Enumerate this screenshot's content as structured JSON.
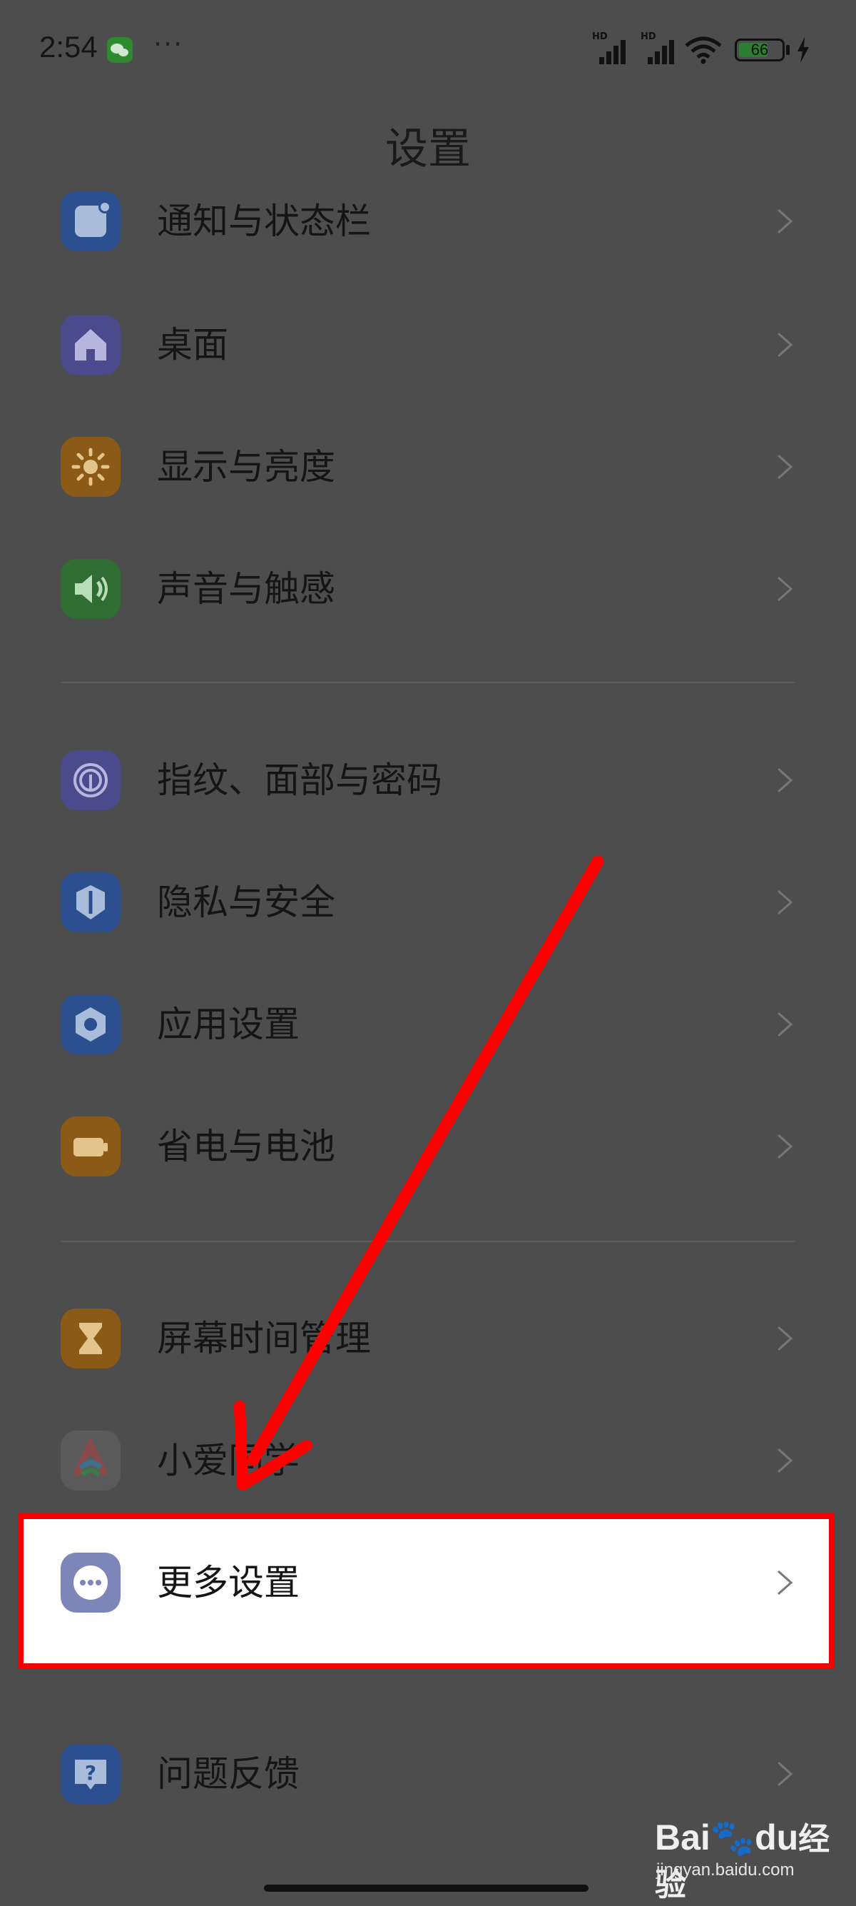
{
  "status_bar": {
    "time": "2:54",
    "more": "···",
    "signal_1_label": "HD",
    "signal_2_label": "HD",
    "battery_level": "66"
  },
  "header": {
    "title": "设置"
  },
  "settings": {
    "group1": [
      {
        "label": "通知与状态栏",
        "icon": "notification-icon",
        "color": "#2b4f8f"
      },
      {
        "label": "桌面",
        "icon": "home-icon",
        "color": "#4b4a8c"
      },
      {
        "label": "显示与亮度",
        "icon": "sun-icon",
        "color": "#8a5a16"
      },
      {
        "label": "声音与触感",
        "icon": "speaker-icon",
        "color": "#2f6d32"
      }
    ],
    "group2": [
      {
        "label": "指纹、面部与密码",
        "icon": "fingerprint-icon",
        "color": "#4b4a8c"
      },
      {
        "label": "隐私与安全",
        "icon": "privacy-shield-icon",
        "color": "#2b4f8f"
      },
      {
        "label": "应用设置",
        "icon": "hexagon-icon",
        "color": "#2b4f8f"
      },
      {
        "label": "省电与电池",
        "icon": "battery-icon",
        "color": "#8a5a16"
      }
    ],
    "group3": [
      {
        "label": "屏幕时间管理",
        "icon": "hourglass-icon",
        "color": "#8a5a16"
      },
      {
        "label": "小爱同学",
        "icon": "xiaoai-icon",
        "color": "#5a5a5a"
      },
      {
        "label": "更多设置",
        "icon": "more-dots-icon",
        "color": "#7d86b8"
      }
    ],
    "group4": [
      {
        "label": "问题反馈",
        "icon": "feedback-icon",
        "color": "#2b4f8f"
      }
    ]
  },
  "watermark": {
    "brand_latin": "Bai",
    "brand_latin_2": "du",
    "brand_cn": "经验",
    "url": "jingyan.baidu.com"
  },
  "colors": {
    "overlay": "#4d4d4d",
    "highlight_border": "#f30000",
    "arrow": "#ff0000"
  }
}
